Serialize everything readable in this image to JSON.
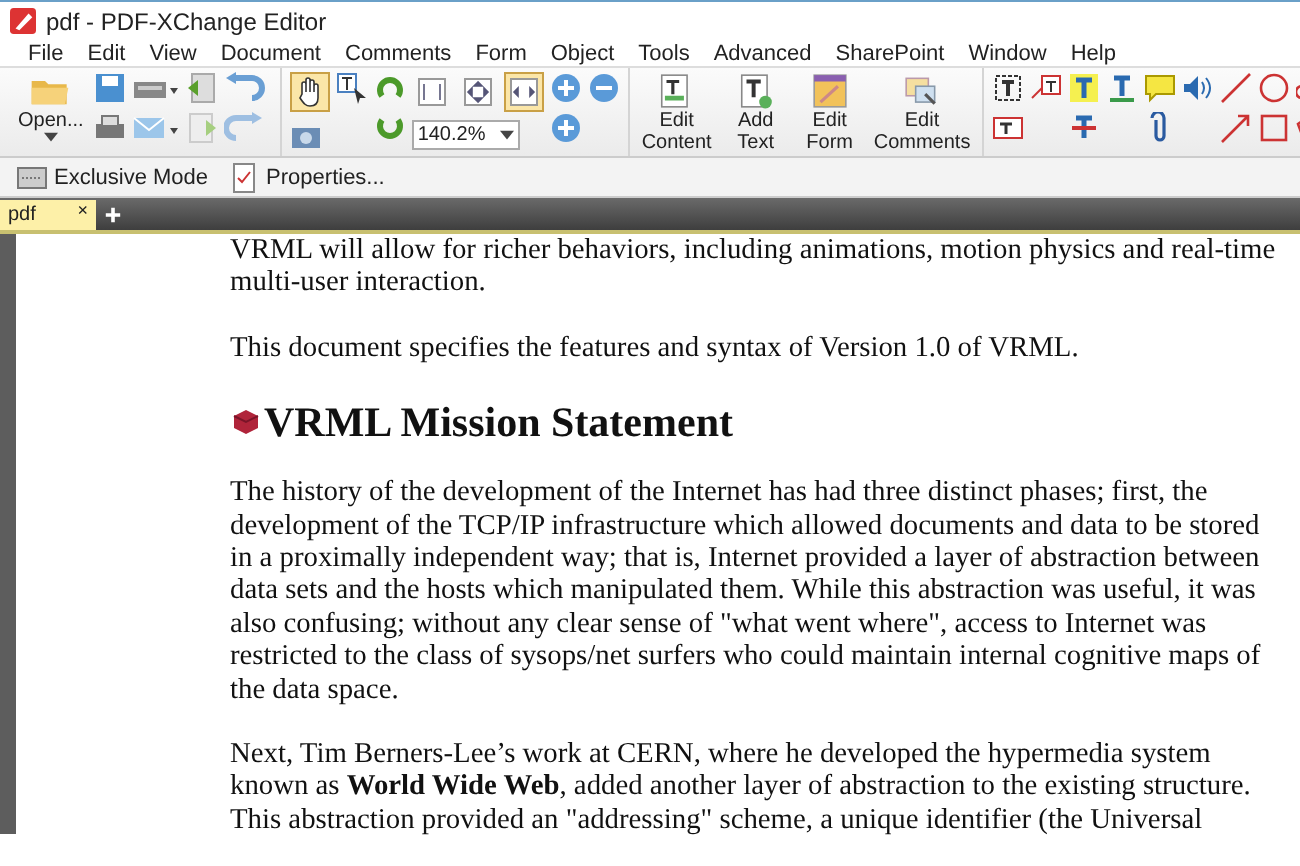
{
  "window": {
    "title": "pdf - PDF-XChange Editor"
  },
  "menu": [
    "File",
    "Edit",
    "View",
    "Document",
    "Comments",
    "Form",
    "Object",
    "Tools",
    "Advanced",
    "SharePoint",
    "Window",
    "Help"
  ],
  "toolbar": {
    "open_label": "Open...",
    "hand_tool": {
      "selected": true
    },
    "view_modes": [
      {
        "selected": false
      },
      {
        "selected": false
      },
      {
        "selected": true
      }
    ],
    "zoom_value": "140.2%",
    "large_buttons": [
      {
        "label": "Edit Content"
      },
      {
        "label": "Add Text"
      },
      {
        "label": "Edit Form"
      },
      {
        "label": "Edit Comments"
      }
    ]
  },
  "secondary_toolbar": [
    "Exclusive Mode",
    "Properties..."
  ],
  "tabs": [
    {
      "label": "pdf",
      "selected": true,
      "close": "×"
    }
  ],
  "document": {
    "paragraphs": [
      {
        "kind": "text",
        "text": "VRML will allow for richer behaviors, including animations, motion physics and real-time multi-user interaction."
      },
      {
        "kind": "text",
        "text": "This document specifies the features and syntax of Version 1.0 of VRML."
      },
      {
        "kind": "heading",
        "text": "VRML Mission Statement"
      },
      {
        "kind": "text",
        "text": "The history of the development of the Internet has had three distinct phases; first, the development of the TCP/IP infrastructure which allowed documents and data to be stored in a proximally independent way; that is, Internet provided a layer of abstraction between data sets and the hosts which manipulated them. While this abstraction was useful, it was also confusing; without any clear sense of \"what went where\", access to Internet was restricted to the class of sysops/net surfers who could maintain internal cognitive maps of the data space."
      },
      {
        "kind": "text",
        "text": "Next, Tim Berners-Lee’s work at CERN, where he developed the hypermedia system known as **World Wide Web**, added another layer of abstraction to the existing structure. This abstraction provided an \"addressing\" scheme, a unique identifier (the Universal"
      }
    ]
  }
}
